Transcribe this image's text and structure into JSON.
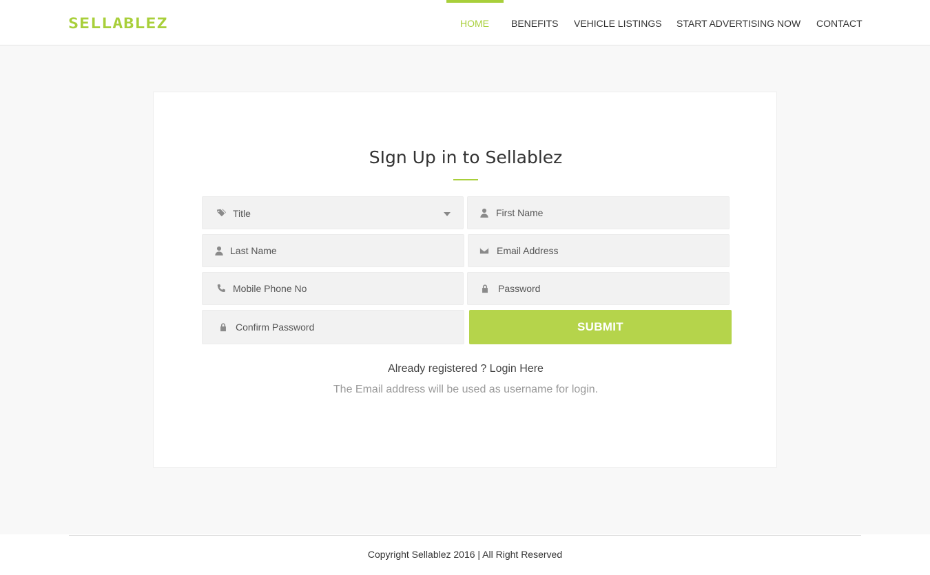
{
  "brand": {
    "logo_text": "SELLABLEZ",
    "accent_color": "#a8cf3a"
  },
  "nav": {
    "items": [
      {
        "label": "HOME",
        "active": true
      },
      {
        "label": "BENEFITS",
        "active": false
      },
      {
        "label": "VEHICLE LISTINGS",
        "active": false
      },
      {
        "label": "START ADVERTISING NOW",
        "active": false
      },
      {
        "label": "CONTACT",
        "active": false
      }
    ]
  },
  "form": {
    "title": "SIgn Up in to Sellablez",
    "title_select": {
      "selected": "Title",
      "icon": "tags-icon"
    },
    "first_name": {
      "placeholder": "First Name",
      "icon": "user-icon"
    },
    "last_name": {
      "placeholder": "Last Name",
      "icon": "user-icon"
    },
    "email": {
      "placeholder": "Email Address",
      "icon": "envelope-icon"
    },
    "mobile": {
      "placeholder": "Mobile Phone No",
      "icon": "phone-icon"
    },
    "password": {
      "placeholder": "Password",
      "icon": "lock-icon"
    },
    "confirm_password": {
      "placeholder": "Confirm Password",
      "icon": "lock-icon"
    },
    "submit_label": "SUBMIT",
    "submit_color": "#b5d44b",
    "already_registered": "Already registered ? Login Here",
    "note": "The Email address will be used as username for login."
  },
  "footer": {
    "copyright": "Copyright Sellablez 2016 | All Right Reserved"
  }
}
